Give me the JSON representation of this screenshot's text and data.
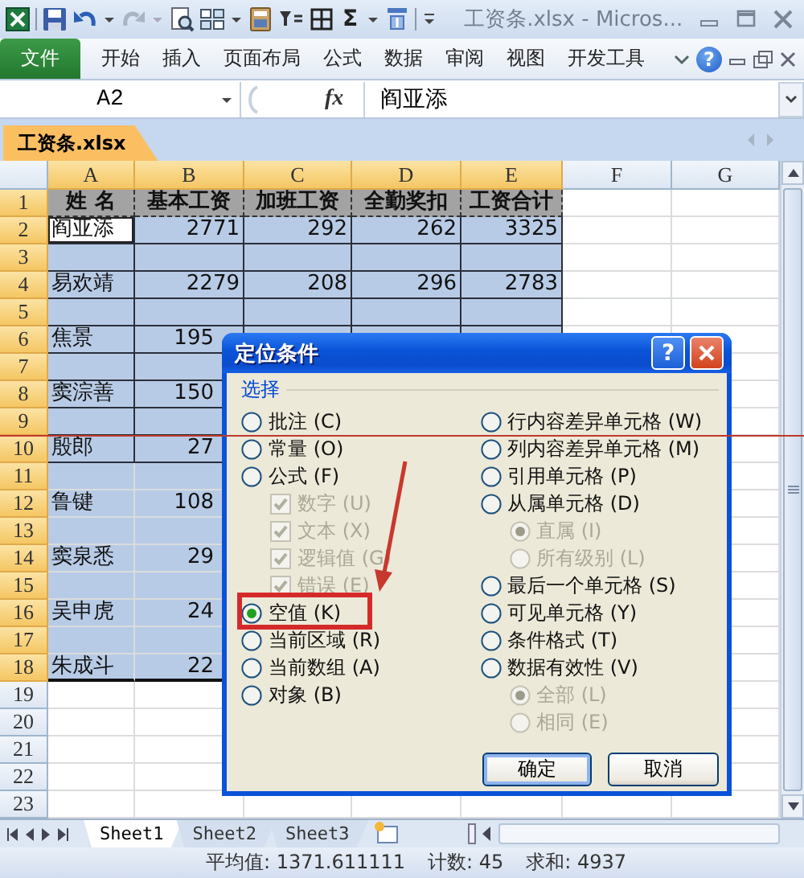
{
  "title_bar": {
    "sum_symbol": "Σ",
    "title": "工资条.xlsx - Micros..."
  },
  "ribbon": {
    "tabs": [
      {
        "label": "文件",
        "kind": "file"
      },
      {
        "label": "开始",
        "kind": "tab"
      },
      {
        "label": "插入",
        "kind": "tab"
      },
      {
        "label": "页面布局",
        "kind": "tab"
      },
      {
        "label": "公式",
        "kind": "tab"
      },
      {
        "label": "数据",
        "kind": "tab"
      },
      {
        "label": "审阅",
        "kind": "tab"
      },
      {
        "label": "视图",
        "kind": "tab"
      },
      {
        "label": "开发工具",
        "kind": "tab"
      }
    ],
    "help": "?"
  },
  "formula_bar": {
    "name_box": "A2",
    "function_label": "fx",
    "content": "阎亚添"
  },
  "workbook_tabs": [
    {
      "label": "工资条.xlsx",
      "selected": true
    }
  ],
  "columns": [
    {
      "label": "A",
      "selected": true
    },
    {
      "label": "B",
      "selected": true
    },
    {
      "label": "C",
      "selected": true
    },
    {
      "label": "D",
      "selected": true
    },
    {
      "label": "E",
      "selected": true
    },
    {
      "label": "F",
      "selected": false
    },
    {
      "label": "G",
      "selected": false
    }
  ],
  "rows": [
    {
      "number": "1",
      "kind": "header",
      "selected": true,
      "bordered": true,
      "active": false,
      "cells": [
        "姓 名",
        "基本工资",
        "加班工资",
        "全勤奖扣",
        "工资合计"
      ]
    },
    {
      "number": "2",
      "kind": "data",
      "selected": true,
      "bordered": true,
      "active": true,
      "cells": [
        "阎亚添",
        "2771",
        "292",
        "262",
        "3325"
      ]
    },
    {
      "number": "3",
      "kind": "data",
      "selected": true,
      "bordered": true,
      "active": false
    },
    {
      "number": "4",
      "kind": "data",
      "selected": true,
      "bordered": true,
      "active": false,
      "cells": [
        "易欢靖",
        "2279",
        "208",
        "296",
        "2783"
      ]
    },
    {
      "number": "5",
      "kind": "data",
      "selected": true,
      "bordered": true,
      "active": false
    },
    {
      "number": "6",
      "kind": "data",
      "selected": true,
      "bordered": true,
      "active": false,
      "cells": [
        "焦景",
        "195"
      ]
    },
    {
      "number": "7",
      "kind": "data",
      "selected": true,
      "bordered": true,
      "active": false
    },
    {
      "number": "8",
      "kind": "data",
      "selected": true,
      "bordered": true,
      "active": false,
      "cells": [
        "窦淙善",
        "150"
      ]
    },
    {
      "number": "9",
      "kind": "data",
      "selected": true,
      "bordered": true,
      "active": false
    },
    {
      "number": "10",
      "kind": "data",
      "selected": true,
      "bordered": true,
      "active": false,
      "cells": [
        "殷郎",
        "27"
      ]
    },
    {
      "number": "11",
      "kind": "data",
      "selected": true,
      "bordered": false,
      "active": false
    },
    {
      "number": "12",
      "kind": "data",
      "selected": true,
      "bordered": false,
      "active": false,
      "cells": [
        "鲁键",
        "108"
      ]
    },
    {
      "number": "13",
      "kind": "data",
      "selected": true,
      "bordered": false,
      "active": false
    },
    {
      "number": "14",
      "kind": "data",
      "selected": true,
      "bordered": false,
      "active": false,
      "cells": [
        "窦泉悉",
        "29"
      ]
    },
    {
      "number": "15",
      "kind": "data",
      "selected": true,
      "bordered": false,
      "active": false
    },
    {
      "number": "16",
      "kind": "data",
      "selected": true,
      "bordered": false,
      "active": false,
      "cells": [
        "吴申虎",
        "24"
      ]
    },
    {
      "number": "17",
      "kind": "data",
      "selected": true,
      "bordered": false,
      "active": false
    },
    {
      "number": "18",
      "kind": "data",
      "selected": true,
      "bordered": false,
      "active": false,
      "cells": [
        "朱成斗",
        "22"
      ]
    },
    {
      "number": "19",
      "kind": "data",
      "selected": false,
      "active": false
    },
    {
      "number": "20",
      "kind": "data",
      "selected": false,
      "active": false
    },
    {
      "number": "21",
      "kind": "data",
      "selected": false,
      "active": false
    },
    {
      "number": "22",
      "kind": "data",
      "selected": false,
      "active": false
    },
    {
      "number": "23",
      "kind": "data",
      "selected": false,
      "active": false
    }
  ],
  "dialog": {
    "title": "定位条件",
    "help": "?",
    "group_label": "选择",
    "left_options": [
      {
        "kind": "radio",
        "label": "批注 (C)",
        "selected": false,
        "disabled": false
      },
      {
        "kind": "radio",
        "label": "常量 (O)",
        "selected": false,
        "disabled": false
      },
      {
        "kind": "radio",
        "label": "公式 (F)",
        "selected": false,
        "disabled": false,
        "children": [
          {
            "kind": "checkbox",
            "label": "数字 (U)",
            "checked": true,
            "disabled": true
          },
          {
            "kind": "checkbox",
            "label": "文本 (X)",
            "checked": true,
            "disabled": true
          },
          {
            "kind": "checkbox",
            "label": "逻辑值 (G)",
            "checked": true,
            "disabled": true
          },
          {
            "kind": "checkbox",
            "label": "错误 (E)",
            "checked": true,
            "disabled": true
          }
        ]
      },
      {
        "kind": "radio",
        "label": "空值 (K)",
        "selected": true,
        "disabled": false
      },
      {
        "kind": "radio",
        "label": "当前区域 (R)",
        "selected": false,
        "disabled": false
      },
      {
        "kind": "radio",
        "label": "当前数组 (A)",
        "selected": false,
        "disabled": false
      },
      {
        "kind": "radio",
        "label": "对象 (B)",
        "selected": false,
        "disabled": false
      }
    ],
    "right_options": [
      {
        "kind": "radio",
        "label": "行内容差异单元格 (W)",
        "selected": false,
        "disabled": false
      },
      {
        "kind": "radio",
        "label": "列内容差异单元格 (M)",
        "selected": false,
        "disabled": false
      },
      {
        "kind": "radio",
        "label": "引用单元格 (P)",
        "selected": false,
        "disabled": false
      },
      {
        "kind": "radio",
        "label": "从属单元格 (D)",
        "selected": false,
        "disabled": false,
        "children": [
          {
            "kind": "radio",
            "label": "直属 (I)",
            "selected": true,
            "disabled": true
          },
          {
            "kind": "radio",
            "label": "所有级别 (L)",
            "selected": false,
            "disabled": true
          }
        ]
      },
      {
        "kind": "radio",
        "label": "最后一个单元格 (S)",
        "selected": false,
        "disabled": false
      },
      {
        "kind": "radio",
        "label": "可见单元格 (Y)",
        "selected": false,
        "disabled": false
      },
      {
        "kind": "radio",
        "label": "条件格式 (T)",
        "selected": false,
        "disabled": false
      },
      {
        "kind": "radio",
        "label": "数据有效性 (V)",
        "selected": false,
        "disabled": false,
        "children": [
          {
            "kind": "radio",
            "label": "全部 (L)",
            "selected": true,
            "disabled": true
          },
          {
            "kind": "radio",
            "label": "相同 (E)",
            "selected": false,
            "disabled": true
          }
        ]
      }
    ],
    "buttons": [
      {
        "label": "确定",
        "default": true
      },
      {
        "label": "取消",
        "default": false
      }
    ]
  },
  "sheet_tabs": [
    {
      "label": "Sheet1",
      "selected": true
    },
    {
      "label": "Sheet2",
      "selected": false
    },
    {
      "label": "Sheet3",
      "selected": false
    }
  ],
  "status_bar": {
    "items": [
      "平均值: 1371.611111",
      "计数: 45",
      "求和: 4937"
    ]
  }
}
